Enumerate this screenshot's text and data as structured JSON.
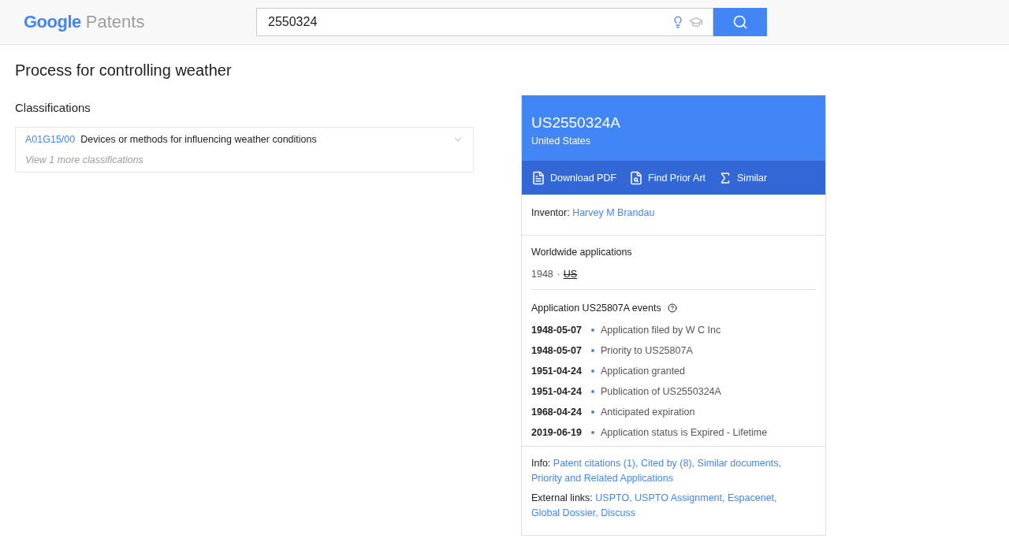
{
  "header": {
    "logo_google": "Google",
    "logo_product": "Patents",
    "search": {
      "value": "2550324"
    }
  },
  "title": "Process for controlling weather",
  "classifications": {
    "heading": "Classifications",
    "items": [
      {
        "code": "A01G15/00",
        "description": "Devices or methods for influencing weather conditions"
      }
    ],
    "more": "View 1 more classifications"
  },
  "card": {
    "number": "US2550324A",
    "country": "United States",
    "actions": [
      {
        "kind": "pdf",
        "label": "Download PDF"
      },
      {
        "kind": "prior-art",
        "label": "Find Prior Art"
      },
      {
        "kind": "similar",
        "label": "Similar"
      }
    ],
    "inventor": {
      "label": "Inventor:",
      "name": "Harvey M Brandau"
    },
    "worldwide": {
      "heading": "Worldwide applications",
      "year": "1948",
      "country": "US"
    },
    "events": {
      "heading": "Application US25807A events",
      "items": [
        {
          "date": "1948-05-07",
          "text": "Application filed by W C Inc"
        },
        {
          "date": "1948-05-07",
          "text": "Priority to US25807A"
        },
        {
          "date": "1951-04-24",
          "text": "Application granted"
        },
        {
          "date": "1951-04-24",
          "text": "Publication of US2550324A"
        },
        {
          "date": "1968-04-24",
          "text": "Anticipated expiration"
        },
        {
          "date": "2019-06-19",
          "text": "Application status is Expired - Lifetime"
        }
      ]
    },
    "info": {
      "label": "Info:",
      "links": [
        "Patent citations (1),",
        "Cited by (8),",
        "Similar documents,",
        "Priority and Related Applications"
      ]
    },
    "external": {
      "label": "External links:",
      "links": [
        "USPTO,",
        "USPTO Assignment,",
        "Espacenet,",
        "Global Dossier,",
        "Discuss"
      ]
    }
  }
}
